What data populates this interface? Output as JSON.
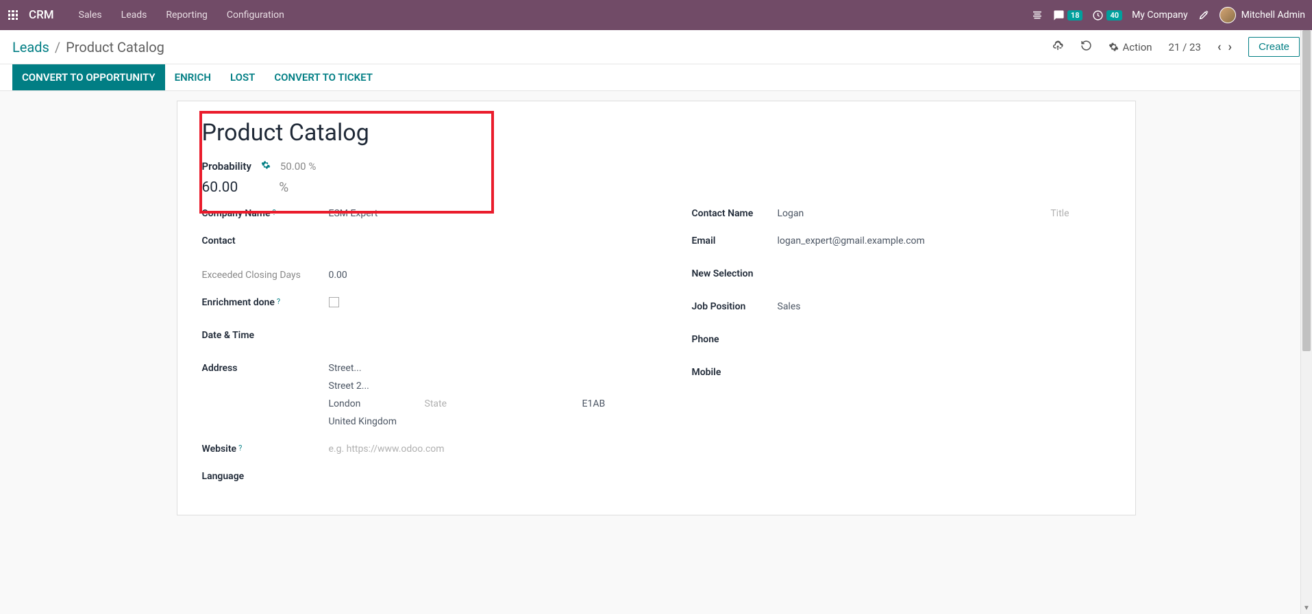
{
  "navbar": {
    "brand": "CRM",
    "items": [
      "Sales",
      "Leads",
      "Reporting",
      "Configuration"
    ],
    "messages_badge": "18",
    "activities_badge": "40",
    "company": "My Company",
    "user": "Mitchell Admin"
  },
  "control": {
    "breadcrumb_parent": "Leads",
    "breadcrumb_current": "Product Catalog",
    "action_label": "Action",
    "pager": "21 / 23",
    "create_label": "Create"
  },
  "status_buttons": {
    "convert_opportunity": "CONVERT TO OPPORTUNITY",
    "enrich": "ENRICH",
    "lost": "LOST",
    "convert_ticket": "CONVERT TO TICKET"
  },
  "form": {
    "title": "Product Catalog",
    "probability_label": "Probability",
    "probability_auto": "50.00 %",
    "probability_value": "60.00",
    "probability_unit": "%",
    "left": {
      "company_name_label": "Company Name",
      "company_name": "ESM Expert",
      "contact_label": "Contact",
      "exceeded_label": "Exceeded Closing Days",
      "exceeded_value": "0.00",
      "enrichment_label": "Enrichment done",
      "datetime_label": "Date & Time",
      "address_label": "Address",
      "street_ph": "Street...",
      "street2_ph": "Street 2...",
      "city": "London",
      "state_ph": "State",
      "zip": "E1AB",
      "country": "United Kingdom",
      "website_label": "Website",
      "website_ph": "e.g. https://www.odoo.com",
      "language_label": "Language"
    },
    "right": {
      "contact_name_label": "Contact Name",
      "contact_name": "Logan",
      "title_ph": "Title",
      "email_label": "Email",
      "email": "logan_expert@gmail.example.com",
      "new_selection_label": "New Selection",
      "job_position_label": "Job Position",
      "job_position": "Sales",
      "phone_label": "Phone",
      "mobile_label": "Mobile"
    }
  }
}
